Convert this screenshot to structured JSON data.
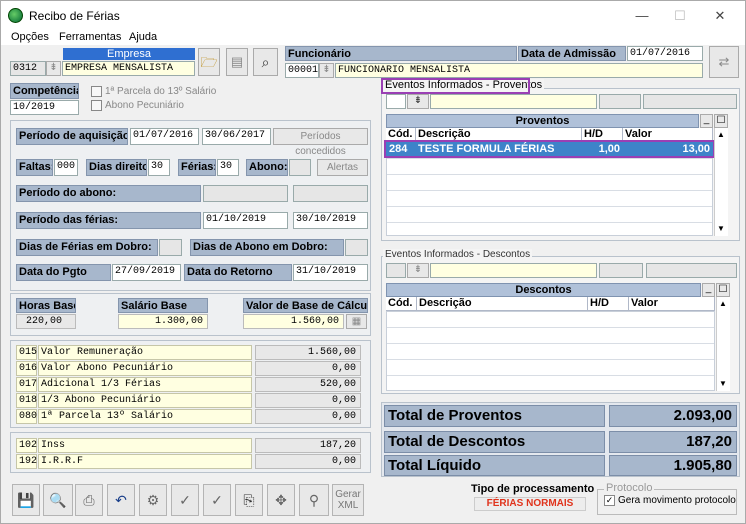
{
  "window": {
    "title": "Recibo de Férias",
    "minimize": "—",
    "maximize": "☐",
    "close": "✕"
  },
  "menu": [
    "Opções",
    "Ferramentas",
    "Ajuda"
  ],
  "empresa": {
    "label": "Empresa",
    "code": "0312",
    "name": "EMPRESA MENSALISTA"
  },
  "funcionario": {
    "label": "Funcionário",
    "code": "00001",
    "name": "FUNCIONARIO MENSALISTA"
  },
  "admissao": {
    "label": "Data de Admissão",
    "value": "01/07/2016"
  },
  "competencia": {
    "label": "Competência",
    "value": "10/2019",
    "opt1": "1ª Parcela do 13º Salário",
    "opt2": "Abono Pecuniário"
  },
  "aquisicao": {
    "label": "Período de aquisição:",
    "start": "01/07/2016",
    "end": "30/06/2017",
    "button": "Períodos concedidos"
  },
  "faltas": {
    "label": "Faltas:",
    "value": "000",
    "direito_label": "Dias direito:",
    "direito": "30",
    "ferias_label": "Férias:",
    "ferias": "30",
    "abono_label": "Abono:",
    "abono": "",
    "alertas": "Alertas"
  },
  "periodo_abono": {
    "label": "Período do abono:"
  },
  "periodo_ferias": {
    "label": "Período das férias:",
    "start": "01/10/2019",
    "end": "30/10/2019"
  },
  "dobro": {
    "ferias_label": "Dias de Férias em Dobro:",
    "abono_label": "Dias de Abono em Dobro:"
  },
  "pgto": {
    "label": "Data do Pgto",
    "value": "27/09/2019",
    "retorno_label": "Data do Retorno",
    "retorno": "31/10/2019"
  },
  "bases": {
    "horas_label": "Horas Base",
    "horas": "220,00",
    "salario_label": "Salário Base",
    "salario": "1.300,00",
    "calculo_label": "Valor de Base de Cálculo",
    "calculo": "1.560,00"
  },
  "verbas": [
    {
      "code": "015",
      "desc": "Valor Remuneração",
      "value": "1.560,00"
    },
    {
      "code": "016",
      "desc": "Valor Abono Pecuniário",
      "value": "0,00"
    },
    {
      "code": "017",
      "desc": "Adicional 1/3 Férias",
      "value": "520,00"
    },
    {
      "code": "018",
      "desc": "1/3 Abono Pecuniário",
      "value": "0,00"
    },
    {
      "code": "080",
      "desc": "1ª Parcela 13º Salário",
      "value": "0,00"
    }
  ],
  "descontos_list": [
    {
      "code": "102",
      "desc": "Inss",
      "value": "187,20"
    },
    {
      "code": "192",
      "desc": "I.R.R.F",
      "value": "0,00"
    }
  ],
  "proventos": {
    "group": "Eventos Informados - Proventos",
    "title": "Proventos",
    "cols": [
      "Cód.",
      "Descrição",
      "H/D",
      "Valor"
    ],
    "rows": [
      {
        "cod": "284",
        "desc": "TESTE FORMULA FÉRIAS",
        "hd": "1,00",
        "valor": "13,00"
      }
    ]
  },
  "descontos": {
    "group": "Eventos Informados - Descontos",
    "title": "Descontos",
    "cols": [
      "Cód.",
      "Descrição",
      "H/D",
      "Valor"
    ]
  },
  "totais": {
    "proventos_label": "Total de Proventos",
    "proventos": "2.093,00",
    "descontos_label": "Total de Descontos",
    "descontos": "187,20",
    "liquido_label": "Total Líquido",
    "liquido": "1.905,80"
  },
  "processamento": {
    "label": "Tipo de processamento",
    "value": "FÉRIAS NORMAIS"
  },
  "protocolo": {
    "label": "Protocolo",
    "check": "Gera movimento protocolo"
  },
  "toolbar": {
    "gerar": "Gerar XML"
  }
}
